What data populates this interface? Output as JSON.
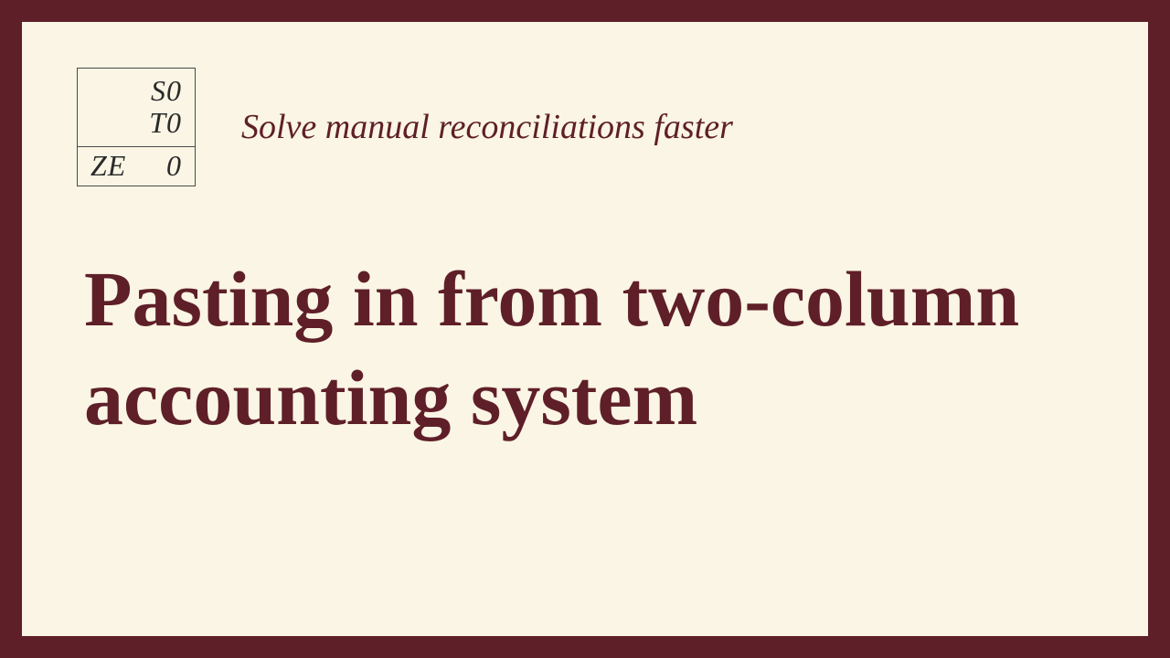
{
  "logo": {
    "line1": "S0",
    "line2": "T0",
    "line3_left": "ZE",
    "line3_right": "0"
  },
  "tagline": "Solve manual reconciliations faster",
  "title": "Pasting in from two-column accounting system",
  "colors": {
    "frame": "#5f1f28",
    "background": "#faf5e4",
    "text": "#5f1f28"
  }
}
